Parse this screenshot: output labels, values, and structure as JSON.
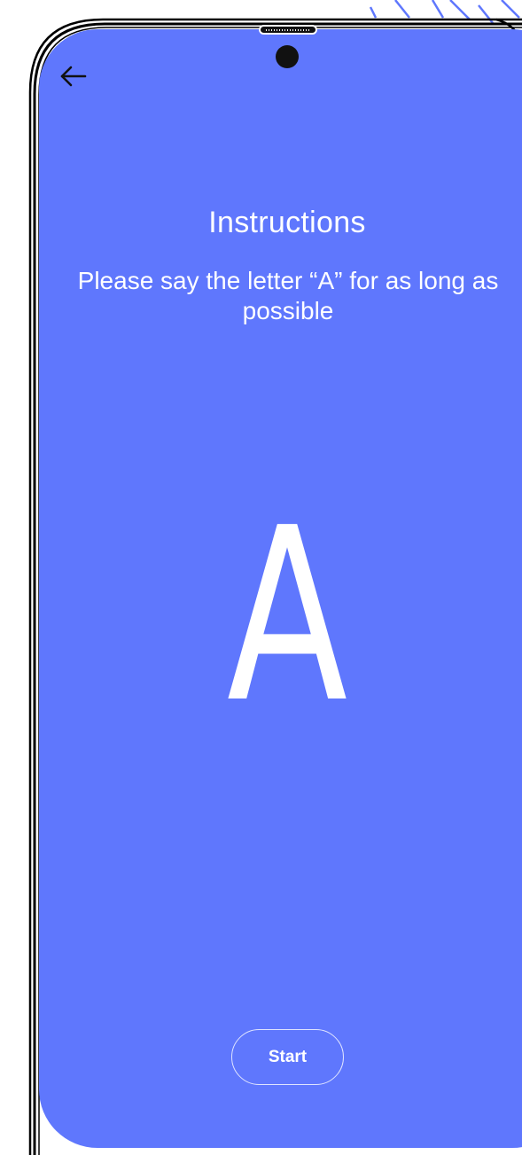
{
  "header": {
    "back_icon": "arrow-left-icon"
  },
  "content": {
    "title": "Instructions",
    "instruction": "Please say the letter “A” for as long as possible",
    "display_letter": "A"
  },
  "footer": {
    "start_label": "Start"
  },
  "colors": {
    "screen_background": "#5f77fd",
    "text": "#ffffff",
    "frame": "#000000",
    "decor_lines": "#5f77fd"
  }
}
